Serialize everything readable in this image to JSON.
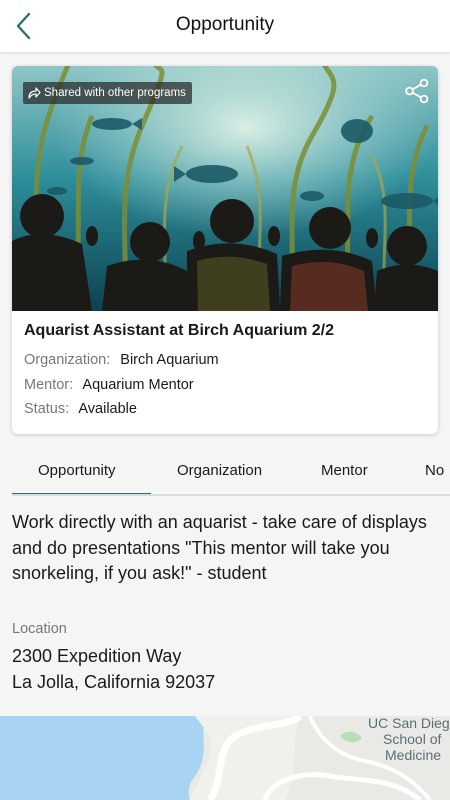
{
  "header": {
    "title": "Opportunity",
    "back_icon": "chevron-left-icon",
    "accent_color": "#2f6f6b"
  },
  "card": {
    "shared_badge": "Shared with other programs",
    "title": "Aquarist Assistant at Birch Aquarium 2/2",
    "fields": [
      {
        "label": "Organization:",
        "value": "Birch Aquarium"
      },
      {
        "label": "Mentor:",
        "value": "Aquarium Mentor"
      },
      {
        "label": "Status:",
        "value": "Available"
      }
    ]
  },
  "tabs": [
    {
      "label": "Opportunity",
      "active": true
    },
    {
      "label": "Organization",
      "active": false
    },
    {
      "label": "Mentor",
      "active": false
    },
    {
      "label": "No",
      "active": false
    }
  ],
  "description": "Work directly with an aquarist - take care of displays and do presentations \"This mentor will take you snorkeling, if you ask!\" - student",
  "location": {
    "label": "Location",
    "line1": "2300 Expedition Way",
    "line2": "La Jolla, California 92037"
  },
  "map": {
    "labels": [
      "UC San Dieg",
      "School of",
      "Medicine"
    ]
  }
}
